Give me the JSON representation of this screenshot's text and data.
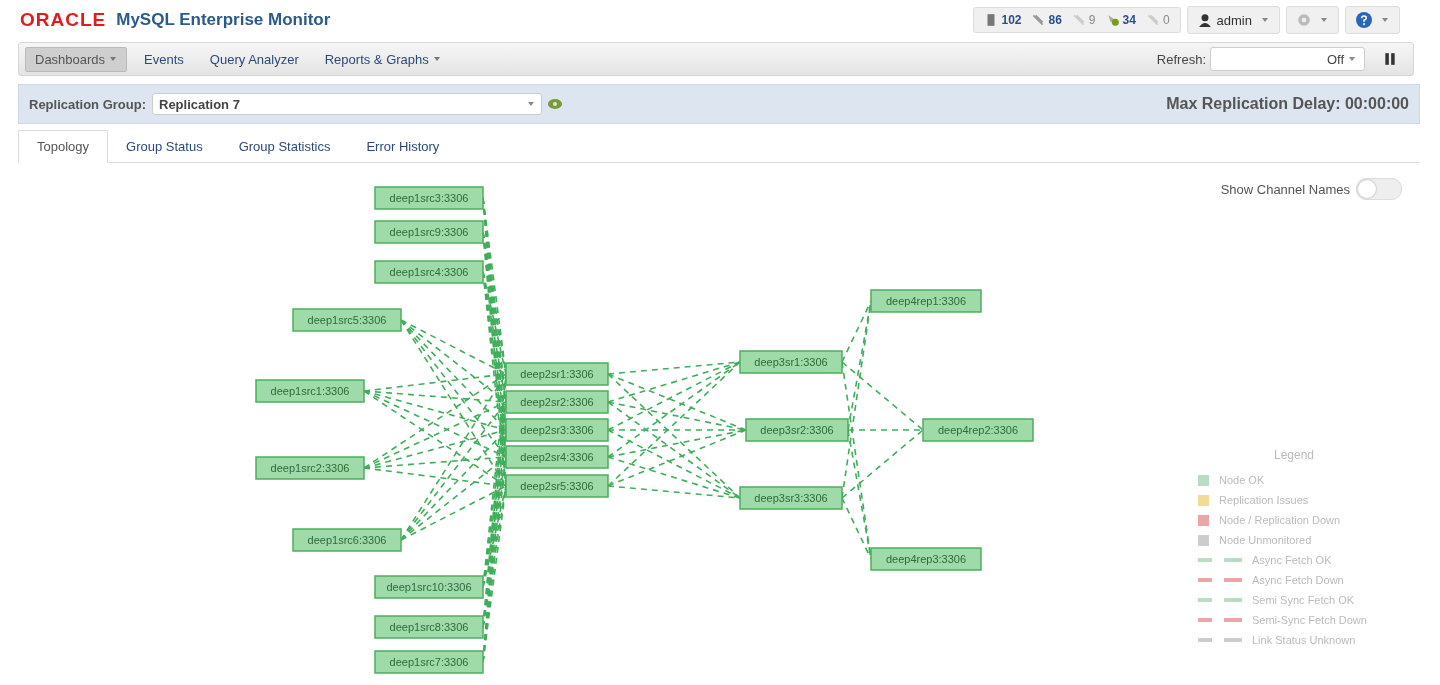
{
  "header": {
    "brand": "ORACLE",
    "product": "MySQL Enterprise Monitor",
    "status_counts": [
      {
        "count": "102",
        "disabled": false
      },
      {
        "count": "86",
        "disabled": false
      },
      {
        "count": "9",
        "disabled": true
      },
      {
        "count": "34",
        "disabled": false
      },
      {
        "count": "0",
        "disabled": true
      }
    ],
    "user": "admin"
  },
  "nav": {
    "items": [
      {
        "label": "Dashboards",
        "selected": true,
        "dropdown": true
      },
      {
        "label": "Events",
        "selected": false,
        "dropdown": false
      },
      {
        "label": "Query Analyzer",
        "selected": false,
        "dropdown": false
      },
      {
        "label": "Reports & Graphs",
        "selected": false,
        "dropdown": true
      }
    ],
    "refresh_label": "Refresh:",
    "refresh_value": "Off"
  },
  "group_bar": {
    "label": "Replication Group:",
    "value": "Replication 7",
    "max_delay": "Max Replication Delay: 00:00:00"
  },
  "tabs": [
    {
      "label": "Topology",
      "selected": true
    },
    {
      "label": "Group Status",
      "selected": false
    },
    {
      "label": "Group Statistics",
      "selected": false
    },
    {
      "label": "Error History",
      "selected": false
    }
  ],
  "topology": {
    "show_channel_names": {
      "label": "Show Channel Names",
      "on": false
    },
    "tiers": [
      [
        "deep1src3:3306",
        "deep1src9:3306",
        "deep1src4:3306",
        "deep1src5:3306",
        "deep1src1:3306",
        "deep1src2:3306",
        "deep1src6:3306",
        "deep1src10:3306",
        "deep1src8:3306",
        "deep1src7:3306"
      ],
      [
        "deep2sr1:3306",
        "deep2sr2:3306",
        "deep2sr3:3306",
        "deep2sr4:3306",
        "deep2sr5:3306"
      ],
      [
        "deep3sr1:3306",
        "deep3sr2:3306",
        "deep3sr3:3306"
      ],
      [
        "deep4rep1:3306",
        "deep4rep2:3306",
        "deep4rep3:3306"
      ]
    ],
    "legend": {
      "title": "Legend",
      "items": [
        {
          "kind": "node",
          "label": "Node OK",
          "color": "#b9dcc3"
        },
        {
          "kind": "node",
          "label": "Replication Issues",
          "color": "#f2dc93"
        },
        {
          "kind": "node",
          "label": "Node / Replication Down",
          "color": "#eaa7a7"
        },
        {
          "kind": "node",
          "label": "Node Unmonitored",
          "color": "#cccccc"
        },
        {
          "kind": "link",
          "label": "Async Fetch OK",
          "color": "#b9dcc3"
        },
        {
          "kind": "link",
          "label": "Async Fetch Down",
          "color": "#eaa7a7"
        },
        {
          "kind": "link",
          "label": "Semi Sync Fetch OK",
          "color": "#b9dcc3"
        },
        {
          "kind": "link",
          "label": "Semi-Sync Fetch Down",
          "color": "#eaa7a7"
        },
        {
          "kind": "link",
          "label": "Link Status Unknown",
          "color": "#cccccc"
        }
      ]
    }
  }
}
